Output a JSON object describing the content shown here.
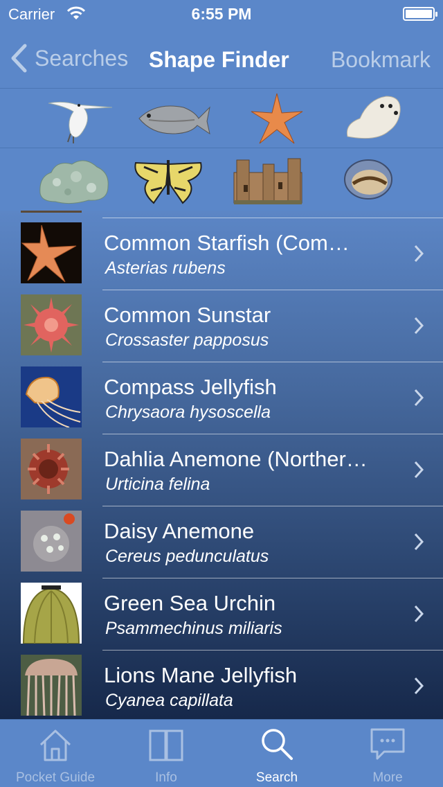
{
  "status_bar": {
    "carrier": "Carrier",
    "time": "6:55 PM",
    "battery_level": 1.0
  },
  "nav": {
    "back_label": "Searches",
    "title": "Shape Finder",
    "bookmark_label": "Bookmark"
  },
  "shape_finder": {
    "row1": [
      "tern-bird-icon",
      "fish-icon",
      "starfish-icon",
      "seal-icon"
    ],
    "row2": [
      "lichen-icon",
      "butterfly-icon",
      "castle-icon",
      "shell-icon"
    ]
  },
  "species": [
    {
      "name": "Common Starfish (Com…",
      "latin": "Asterias rubens"
    },
    {
      "name": "Common Sunstar",
      "latin": "Crossaster papposus"
    },
    {
      "name": "Compass Jellyfish",
      "latin": "Chrysaora hysoscella"
    },
    {
      "name": "Dahlia Anemone (Norther…",
      "latin": "Urticina felina"
    },
    {
      "name": "Daisy Anemone",
      "latin": "Cereus pedunculatus"
    },
    {
      "name": "Green Sea Urchin",
      "latin": "Psammechinus miliaris"
    },
    {
      "name": "Lions Mane Jellyfish",
      "latin": "Cyanea capillata"
    }
  ],
  "tabs": [
    {
      "label": "Pocket Guide",
      "icon": "house-icon",
      "active": false
    },
    {
      "label": "Info",
      "icon": "book-icon",
      "active": false
    },
    {
      "label": "Search",
      "icon": "magnifier-icon",
      "active": true
    },
    {
      "label": "More",
      "icon": "speech-bubble-icon",
      "active": false
    }
  ],
  "colors": {
    "bar": "#5b87c9",
    "inactive_tab": "#a9c0e2",
    "nav_button": "#b9cde8"
  }
}
